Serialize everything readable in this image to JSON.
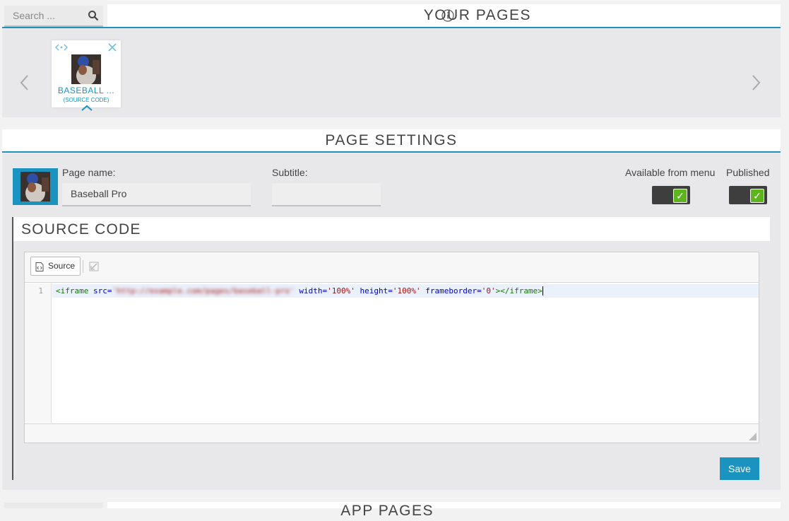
{
  "search": {
    "placeholder": "Search ..."
  },
  "your_pages": {
    "title": "YOUR PAGES",
    "cards": [
      {
        "title": "BASEBALL ...",
        "subtitle": "(SOURCE CODE)"
      }
    ]
  },
  "page_settings": {
    "title": "PAGE SETTINGS",
    "page_name_label": "Page name:",
    "page_name_value": "Baseball Pro",
    "subtitle_label": "Subtitle:",
    "subtitle_value": "",
    "available_label": "Available from menu",
    "available_checked": true,
    "published_label": "Published",
    "published_checked": true
  },
  "source_code": {
    "title": "SOURCE CODE",
    "source_button": "Source",
    "line_number": "1",
    "code": {
      "tag_open": "<iframe",
      "src_attr": " src=",
      "src_value": "'http://example.com/pages/baseball-pro'",
      "width_attr": " width=",
      "width_value": "'100%'",
      "height_attr": " height=",
      "height_value": "'100%'",
      "frameborder_attr": " frameborder=",
      "frameborder_value": "'0'",
      "tag_close": "></iframe>"
    },
    "save_button": "Save"
  },
  "app_pages": {
    "title": "APP PAGES"
  },
  "colors": {
    "accent": "#1a93c0",
    "toggle_check": "#5db41c",
    "code_tag": "#117700",
    "code_attr": "#0000cc",
    "code_string": "#aa1111"
  }
}
